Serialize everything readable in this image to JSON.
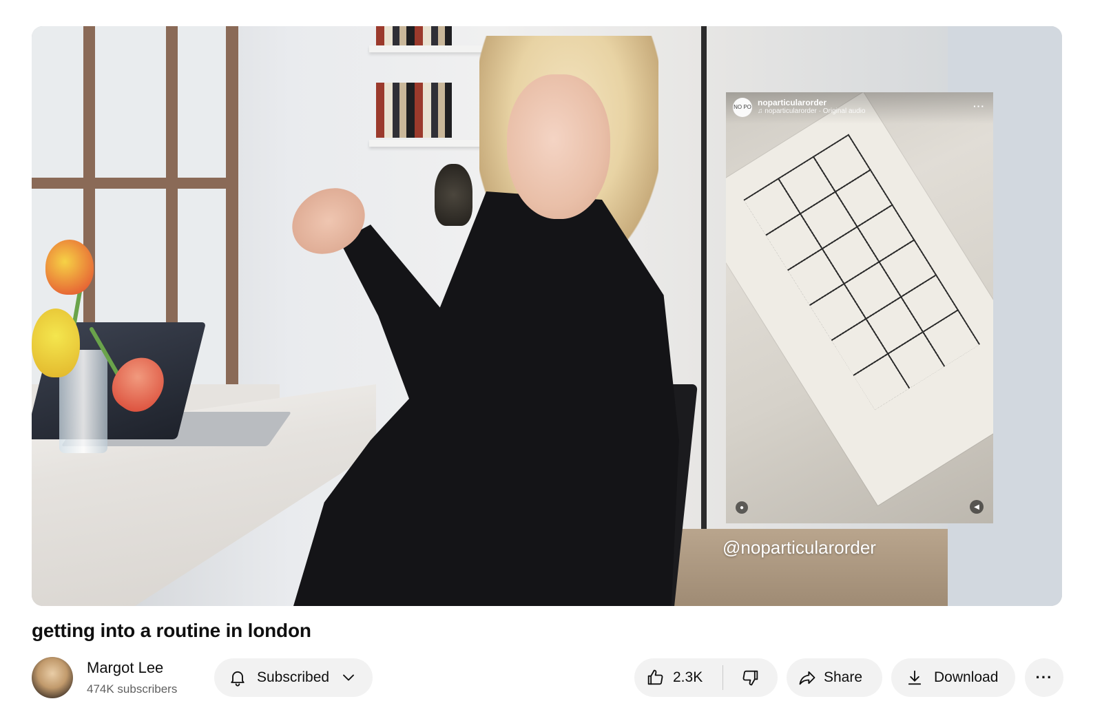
{
  "video": {
    "overlay_handle": "@noparticularorder",
    "reel": {
      "avatar_text": "NO PO",
      "username": "noparticularorder",
      "audio": "♫ noparticularorder · Original audio",
      "more": "···"
    }
  },
  "title": "getting into a routine in london",
  "channel": {
    "name": "Margot Lee",
    "subscribers": "474K subscribers"
  },
  "actions": {
    "subscribe_label": "Subscribed",
    "like_count": "2.3K",
    "share_label": "Share",
    "download_label": "Download",
    "more_label": "···"
  },
  "icons": {
    "bell": "bell-icon",
    "chevron": "chevron-down-icon",
    "like": "thumbs-up-icon",
    "dislike": "thumbs-down-icon",
    "share": "share-arrow-icon",
    "download": "download-icon",
    "more": "more-horizontal-icon"
  },
  "colors": {
    "button_bg": "#f2f2f2",
    "text_primary": "#0f0f0f",
    "text_secondary": "#606060"
  }
}
